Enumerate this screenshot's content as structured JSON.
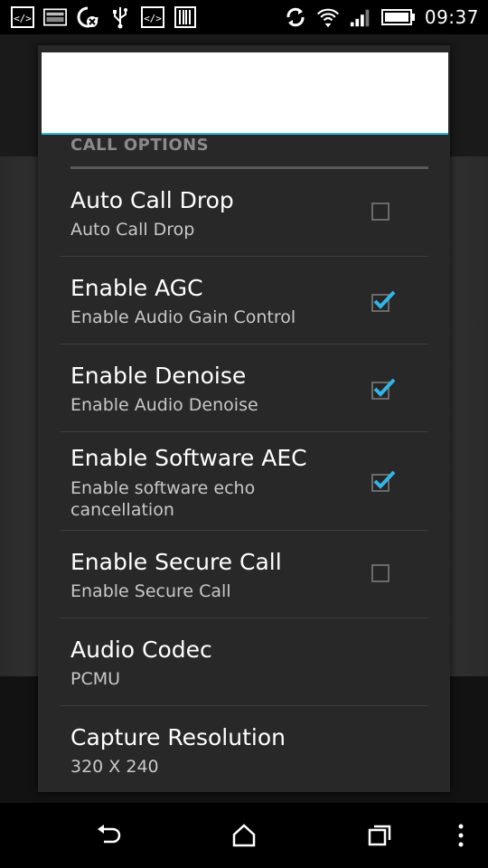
{
  "status_bar": {
    "time": "09:37",
    "left_icons": [
      "code-icon",
      "image-icon",
      "sync-disabled-icon",
      "usb-icon",
      "code-icon",
      "barcode-icon"
    ],
    "right_icons": [
      "sync-icon",
      "wifi-icon",
      "signal-icon",
      "battery-icon"
    ]
  },
  "dialog": {
    "section_title": "CALL OPTIONS",
    "items": [
      {
        "title": "Auto Call Drop",
        "summary": "Auto Call Drop",
        "has_checkbox": true,
        "checked": false
      },
      {
        "title": "Enable AGC",
        "summary": "Enable Audio Gain Control",
        "has_checkbox": true,
        "checked": true
      },
      {
        "title": "Enable Denoise",
        "summary": "Enable Audio Denoise",
        "has_checkbox": true,
        "checked": true
      },
      {
        "title": "Enable Software AEC",
        "summary": "Enable software echo cancellation",
        "has_checkbox": true,
        "checked": true
      },
      {
        "title": "Enable Secure Call",
        "summary": "Enable Secure Call",
        "has_checkbox": true,
        "checked": false
      },
      {
        "title": "Audio Codec",
        "summary": "PCMU",
        "has_checkbox": false
      },
      {
        "title": "Capture Resolution",
        "summary": "320 X 240",
        "has_checkbox": false
      }
    ]
  },
  "nav_bar": {
    "buttons": [
      "back-icon",
      "home-icon",
      "recent-apps-icon",
      "menu-icon"
    ]
  },
  "colors": {
    "accent": "#33b5e5",
    "dialog_bg": "#282828",
    "section_text": "#8a8a8a"
  }
}
